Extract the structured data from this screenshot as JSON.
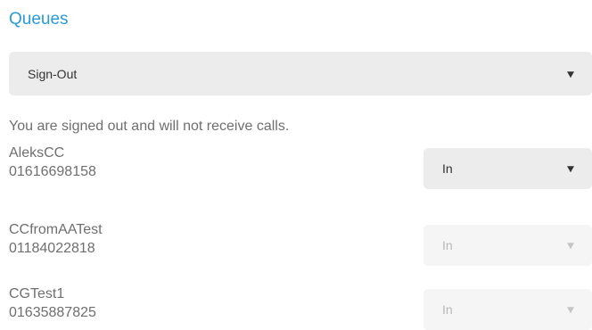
{
  "page": {
    "title": "Queues",
    "status_select": {
      "value": "Sign-Out"
    },
    "status_message": "You are signed out and will not receive calls."
  },
  "queues": [
    {
      "name": "AleksCC",
      "number": "01616698158",
      "selected": "In",
      "enabled": true
    },
    {
      "name": "CCfromAATest",
      "number": "01184022818",
      "selected": "In",
      "enabled": false
    },
    {
      "name": "CGTest1",
      "number": "01635887825",
      "selected": "In",
      "enabled": false
    }
  ],
  "colors": {
    "accent": "#2a9bdb",
    "select_background": "#ececec",
    "disabled_background": "#f5f5f5",
    "text": "#6f6f6f"
  },
  "icons": {
    "dropdown": "chevron-down-icon"
  }
}
